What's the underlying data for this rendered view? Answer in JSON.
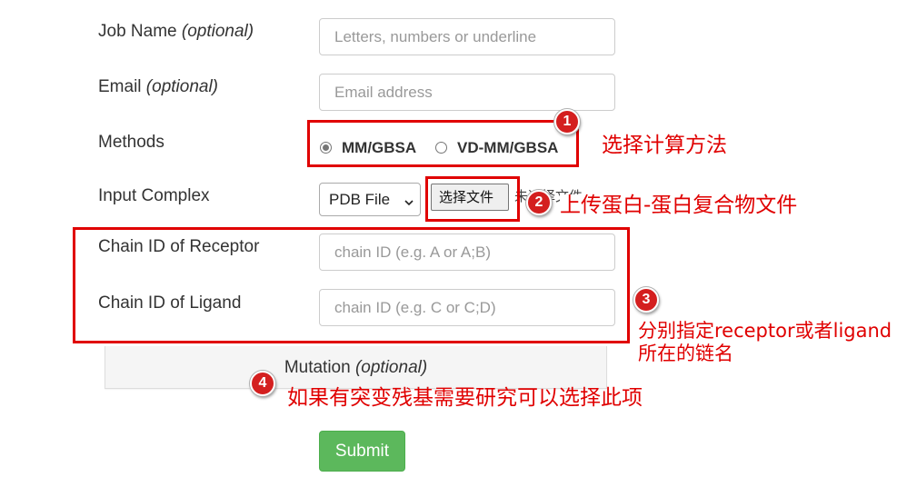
{
  "form": {
    "job_name": {
      "label": "Job Name",
      "label_suffix": "(optional)",
      "placeholder": "Letters, numbers or underline"
    },
    "email": {
      "label": "Email",
      "label_suffix": "(optional)",
      "placeholder": "Email address"
    },
    "methods": {
      "label": "Methods",
      "options": [
        {
          "label": "MM/GBSA",
          "checked": true
        },
        {
          "label": "VD-MM/GBSA",
          "checked": false
        }
      ]
    },
    "input_complex": {
      "label": "Input Complex",
      "select_value": "PDB File",
      "file_button": "选择文件",
      "file_status": "未选择文件"
    },
    "receptor": {
      "label": "Chain ID of Receptor",
      "placeholder": "chain ID (e.g. A or A;B)"
    },
    "ligand": {
      "label": "Chain ID of Ligand",
      "placeholder": "chain ID (e.g. C or C;D)"
    },
    "mutation": {
      "label": "Mutation",
      "label_suffix": "(optional)"
    },
    "submit_label": "Submit"
  },
  "annotations": [
    {
      "number": "1",
      "text": "选择计算方法"
    },
    {
      "number": "2",
      "text": "上传蛋白-蛋白复合物文件"
    },
    {
      "number": "3",
      "text_line1": "分别指定receptor或者ligand",
      "text_line2": "所在的链名"
    },
    {
      "number": "4",
      "text": "如果有突变残基需要研究可以选择此项"
    }
  ],
  "colors": {
    "annotation_red": "#e00000",
    "badge_red": "#d41f1f",
    "submit_green": "#5cb85c",
    "text": "#333333",
    "placeholder": "#999999"
  }
}
